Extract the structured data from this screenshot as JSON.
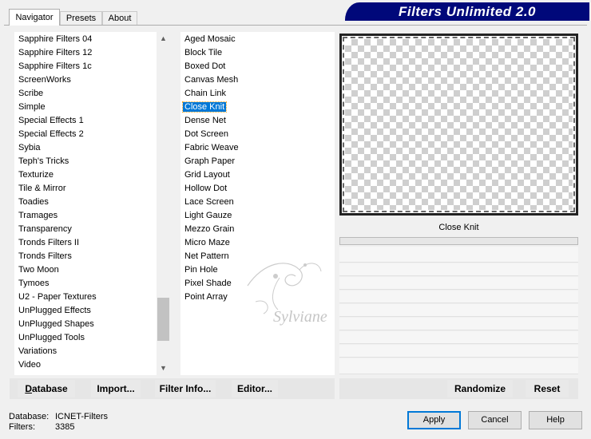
{
  "tabs": [
    "Navigator",
    "Presets",
    "About"
  ],
  "banner_title": "Filters Unlimited 2.0",
  "categories": {
    "items": [
      "Sapphire Filters 04",
      "Sapphire Filters 12",
      "Sapphire Filters 1c",
      "ScreenWorks",
      "Scribe",
      "Simple",
      "Special Effects 1",
      "Special Effects 2",
      "Sybia",
      "Teph's Tricks",
      "Texturize",
      "Tile & Mirror",
      "Toadies",
      "Tramages",
      "Transparency",
      "Tronds Filters II",
      "Tronds Filters",
      "Two Moon",
      "Tymoes",
      "U2 - Paper Textures",
      "UnPlugged Effects",
      "UnPlugged Shapes",
      "UnPlugged Tools",
      "Variations",
      "Video"
    ],
    "selected_index": 3
  },
  "filters": {
    "items": [
      "Aged Mosaic",
      "Block Tile",
      "Boxed Dot",
      "Canvas Mesh",
      "Chain Link",
      "Close Knit",
      "Dense Net",
      "Dot Screen",
      "Fabric Weave",
      "Graph Paper",
      "Grid Layout",
      "Hollow Dot",
      "Lace Screen",
      "Light Gauze",
      "Mezzo Grain",
      "Micro Maze",
      "Net Pattern",
      "Pin Hole",
      "Pixel Shade",
      "Point Array"
    ],
    "selected_index": 5
  },
  "preview": {
    "filter_name": "Close Knit"
  },
  "watermark_text": "Sylviane",
  "toolbar": {
    "database": "Database",
    "import": "Import...",
    "filter_info": "Filter Info...",
    "editor": "Editor...",
    "randomize": "Randomize",
    "reset": "Reset"
  },
  "status": {
    "database_label": "Database:",
    "database_value": "ICNET-Filters",
    "filters_label": "Filters:",
    "filters_value": "3385"
  },
  "buttons": {
    "apply": "Apply",
    "cancel": "Cancel",
    "help": "Help"
  },
  "colors": {
    "banner_bg": "#00087a",
    "selection": "#0078d7"
  }
}
